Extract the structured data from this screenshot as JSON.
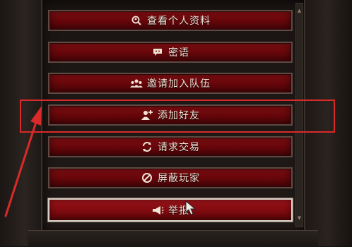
{
  "menu": {
    "items": [
      {
        "label": "查看个人资料",
        "icon": "magnifier-person-icon"
      },
      {
        "label": "密语",
        "icon": "speech-bubble-icon"
      },
      {
        "label": "邀请加入队伍",
        "icon": "group-icon"
      },
      {
        "label": "添加好友",
        "icon": "add-friend-icon"
      },
      {
        "label": "请求交易",
        "icon": "trade-cycle-icon"
      },
      {
        "label": "屏蔽玩家",
        "icon": "block-icon"
      },
      {
        "label": "举报",
        "icon": "megaphone-icon"
      }
    ]
  },
  "colors": {
    "button_red": "#7a0a0e",
    "annotation_red": "#d92a2a",
    "text": "#efe3d6"
  }
}
